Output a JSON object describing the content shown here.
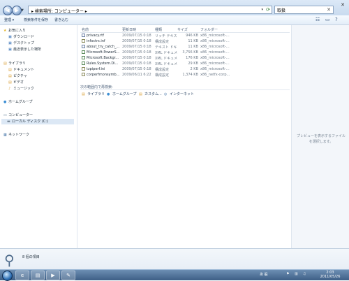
{
  "address": {
    "breadcrumb": "▸ 検索場所: コンピューター ▸",
    "search_value": "取扱"
  },
  "toolbar": {
    "organize": "整理 ▾",
    "save_search": "検索条件を保存",
    "burn": "書き込む"
  },
  "nav": {
    "favorites": "お気に入り",
    "downloads": "ダウンロード",
    "desktop": "デスクトップ",
    "recent": "最近表示した場所",
    "libraries": "ライブラリ",
    "documents": "ドキュメント",
    "pictures": "ピクチャ",
    "videos": "ビデオ",
    "music": "ミュージック",
    "homegroup": "ホームグループ",
    "computer": "コンピューター",
    "local_disk": "ローカル ディスク (C:)",
    "network": "ネットワーク"
  },
  "columns": {
    "name": "名前",
    "modified": "更新日時",
    "type": "種類",
    "size": "サイズ",
    "folder": "フォルダー"
  },
  "files": [
    {
      "name": "privacy.rtf",
      "date": "2009/07/15 0:18",
      "type": "リッチ テキスト...",
      "size": "946 KB",
      "folder": "x86_microsoft-...",
      "icon": "txt"
    },
    {
      "name": "infoctrs.inf",
      "date": "2009/07/15 0:18",
      "type": "構成設定",
      "size": "11 KB",
      "folder": "x86_microsoft-...",
      "icon": "ini"
    },
    {
      "name": "about_try_catch_...",
      "date": "2009/07/15 0:18",
      "type": "テキスト ドキュ...",
      "size": "11 KB",
      "folder": "x86_microsoft-...",
      "icon": "txt"
    },
    {
      "name": "Microsoft.PowerS...",
      "date": "2009/07/15 0:18",
      "type": "XML ドキュメント",
      "size": "3,756 KB",
      "folder": "x86_microsoft-...",
      "icon": "xml"
    },
    {
      "name": "Microsoft.Backgr...",
      "date": "2009/07/15 0:18",
      "type": "XML ドキュメント",
      "size": "176 KB",
      "folder": "x86_microsoft-...",
      "icon": "xml"
    },
    {
      "name": "Rules.System.Di...",
      "date": "2009/07/15 0:18",
      "type": "XML ドキュメント",
      "size": "29 KB",
      "folder": "x86_microsoft-...",
      "icon": "xml"
    },
    {
      "name": "tzpiperf.ini",
      "date": "2009/07/15 0:18",
      "type": "構成設定",
      "size": "2 KB",
      "folder": "x86_microsoft-...",
      "icon": "ini"
    },
    {
      "name": "corperfmonsymb...",
      "date": "2009/06/11 6:22",
      "type": "構成設定",
      "size": "1,374 KB",
      "folder": "x86_netfx-corp...",
      "icon": "ini"
    }
  ],
  "search_again": {
    "label": "次の範囲内で再検索:",
    "locations": [
      "ライブラリ",
      "ホームグループ",
      "カスタム...",
      "インターネット"
    ]
  },
  "preview": {
    "message": "プレビューを表示するファイルを選択します。"
  },
  "details": {
    "count": "8 個の項目"
  },
  "taskbar": {
    "tray_text": "あ 般",
    "clock_time": "2:03",
    "clock_date": "2011/05/26"
  }
}
